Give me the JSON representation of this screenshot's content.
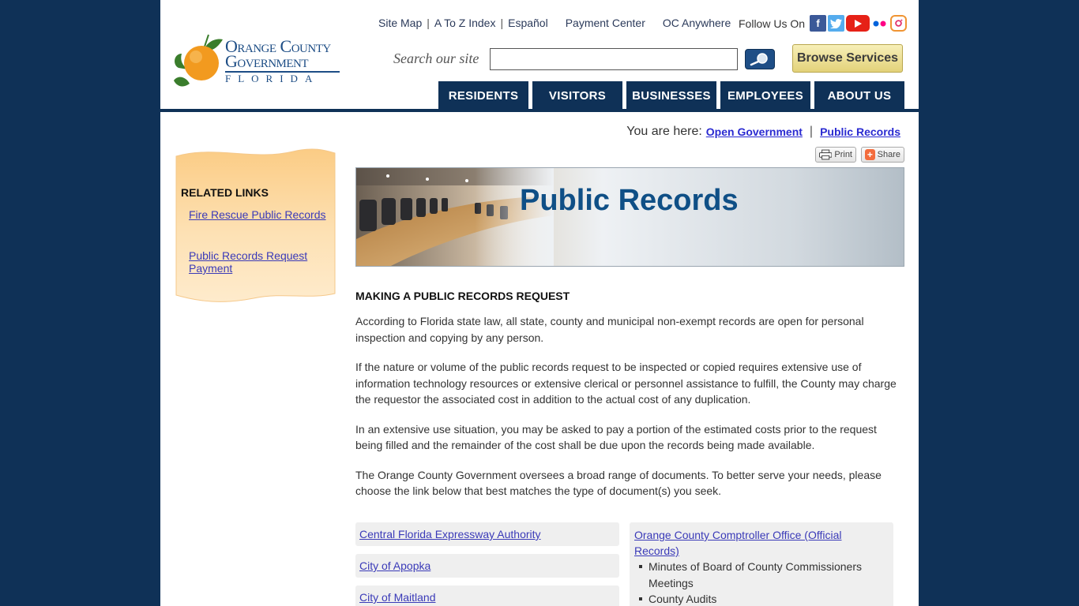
{
  "logo": {
    "line1": "Orange County",
    "line2": "Government",
    "line3": "FLORIDA"
  },
  "util_links": [
    "Site Map",
    "A To Z Index",
    "Español"
  ],
  "util_links2": [
    "Payment Center",
    "OC Anywhere"
  ],
  "follow": {
    "label": "Follow Us On",
    "icons": [
      "facebook-icon",
      "twitter-icon",
      "youtube-icon",
      "flickr-icon",
      "instagram-icon"
    ]
  },
  "search": {
    "label": "Search our site",
    "value": "",
    "placeholder": ""
  },
  "browse_label": "Browse Services",
  "nav": [
    "RESIDENTS",
    "VISITORS",
    "BUSINESSES",
    "EMPLOYEES",
    "ABOUT US"
  ],
  "breadcrumb": {
    "prefix": "You are here:",
    "items": [
      "Open Government",
      "Public Records"
    ]
  },
  "tools": {
    "print": "Print",
    "share": "Share"
  },
  "sidebar": {
    "title": "RELATED LINKS",
    "links": [
      "Fire Rescue Public Records",
      "Public Records Request Payment"
    ]
  },
  "banner_title": "Public Records",
  "content": {
    "heading": "MAKING A PUBLIC RECORDS REQUEST",
    "paragraphs": [
      "According to Florida state law, all state, county and municipal non-exempt records are open for personal inspection and copying by any person.",
      "If the nature or volume of the public records request to be inspected or copied requires extensive use of information technology resources or extensive clerical or personnel assistance to fulfill, the County may charge the requestor the associated cost in addition to the actual cost of any duplication.",
      "In an extensive use situation, you may be asked to pay a portion of the estimated costs prior to the request being filled and the remainder of the cost shall be due upon the records being made available.",
      "The Orange County Government oversees a broad range of documents. To better serve your needs, please choose the link below that best matches the type of document(s) you seek."
    ]
  },
  "record_links_left": [
    "Central Florida Expressway Authority",
    "City of Apopka",
    "City of Maitland"
  ],
  "record_box_right": {
    "title": "Orange County Comptroller Office (Official Records)",
    "items": [
      "Minutes of Board of County Commissioners Meetings",
      "County Audits"
    ]
  },
  "colors": {
    "navy": "#0f3157",
    "link": "#3a3ab8",
    "banner_title": "#0f4f86"
  }
}
